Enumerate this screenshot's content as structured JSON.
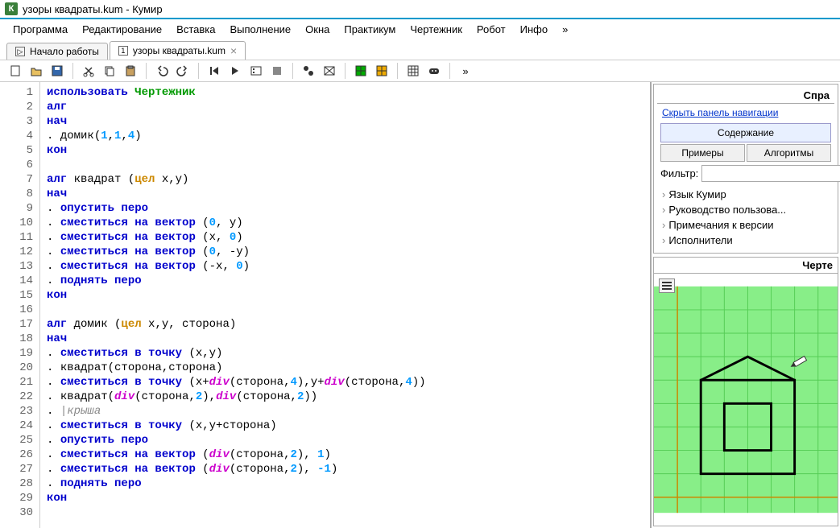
{
  "title": "узоры квадраты.kum - Кумир",
  "app_icon_letter": "К",
  "menu": [
    "Программа",
    "Редактирование",
    "Вставка",
    "Выполнение",
    "Окна",
    "Практикум",
    "Чертежник",
    "Робот",
    "Инфо",
    "»"
  ],
  "tabs": [
    {
      "label": "Начало работы",
      "icon": "▷",
      "closable": false
    },
    {
      "label": "узоры квадраты.kum",
      "icon": "1",
      "closable": true
    }
  ],
  "active_tab": 1,
  "code_lines": [
    {
      "n": 1,
      "segs": [
        {
          "t": "использовать ",
          "c": "kw"
        },
        {
          "t": "Чертежник",
          "c": "fn"
        }
      ]
    },
    {
      "n": 2,
      "segs": [
        {
          "t": "алг",
          "c": "kw"
        }
      ]
    },
    {
      "n": 3,
      "segs": [
        {
          "t": "нач",
          "c": "kw"
        }
      ]
    },
    {
      "n": 4,
      "segs": [
        {
          "t": ". ",
          "c": "dot"
        },
        {
          "t": "домик(",
          "c": ""
        },
        {
          "t": "1",
          "c": "num"
        },
        {
          "t": ",",
          "c": ""
        },
        {
          "t": "1",
          "c": "num"
        },
        {
          "t": ",",
          "c": ""
        },
        {
          "t": "4",
          "c": "num"
        },
        {
          "t": ")",
          "c": ""
        }
      ]
    },
    {
      "n": 5,
      "segs": [
        {
          "t": "кон",
          "c": "kw"
        }
      ]
    },
    {
      "n": 6,
      "segs": []
    },
    {
      "n": 7,
      "segs": [
        {
          "t": "алг ",
          "c": "kw"
        },
        {
          "t": "квадрат (",
          "c": ""
        },
        {
          "t": "цел",
          "c": "ty"
        },
        {
          "t": " x,y)",
          "c": ""
        }
      ]
    },
    {
      "n": 8,
      "segs": [
        {
          "t": "нач",
          "c": "kw"
        }
      ]
    },
    {
      "n": 9,
      "segs": [
        {
          "t": ". ",
          "c": "dot"
        },
        {
          "t": "опустить перо",
          "c": "kw"
        }
      ]
    },
    {
      "n": 10,
      "segs": [
        {
          "t": ". ",
          "c": "dot"
        },
        {
          "t": "сместиться на вектор",
          "c": "kw"
        },
        {
          "t": " (",
          "c": ""
        },
        {
          "t": "0",
          "c": "num"
        },
        {
          "t": ", y)",
          "c": ""
        }
      ]
    },
    {
      "n": 11,
      "segs": [
        {
          "t": ". ",
          "c": "dot"
        },
        {
          "t": "сместиться на вектор",
          "c": "kw"
        },
        {
          "t": " (x, ",
          "c": ""
        },
        {
          "t": "0",
          "c": "num"
        },
        {
          "t": ")",
          "c": ""
        }
      ]
    },
    {
      "n": 12,
      "segs": [
        {
          "t": ". ",
          "c": "dot"
        },
        {
          "t": "сместиться на вектор",
          "c": "kw"
        },
        {
          "t": " (",
          "c": ""
        },
        {
          "t": "0",
          "c": "num"
        },
        {
          "t": ", -y)",
          "c": ""
        }
      ]
    },
    {
      "n": 13,
      "segs": [
        {
          "t": ". ",
          "c": "dot"
        },
        {
          "t": "сместиться на вектор",
          "c": "kw"
        },
        {
          "t": " (-x, ",
          "c": ""
        },
        {
          "t": "0",
          "c": "num"
        },
        {
          "t": ")",
          "c": ""
        }
      ]
    },
    {
      "n": 14,
      "segs": [
        {
          "t": ". ",
          "c": "dot"
        },
        {
          "t": "поднять перо",
          "c": "kw"
        }
      ]
    },
    {
      "n": 15,
      "segs": [
        {
          "t": "кон",
          "c": "kw"
        }
      ]
    },
    {
      "n": 16,
      "segs": []
    },
    {
      "n": 17,
      "segs": [
        {
          "t": "алг ",
          "c": "kw"
        },
        {
          "t": "домик (",
          "c": ""
        },
        {
          "t": "цел",
          "c": "ty"
        },
        {
          "t": " x,y, сторона)",
          "c": ""
        }
      ]
    },
    {
      "n": 18,
      "segs": [
        {
          "t": "нач",
          "c": "kw"
        }
      ]
    },
    {
      "n": 19,
      "segs": [
        {
          "t": ". ",
          "c": "dot"
        },
        {
          "t": "сместиться в точку",
          "c": "kw"
        },
        {
          "t": " (x,y)",
          "c": ""
        }
      ]
    },
    {
      "n": 20,
      "segs": [
        {
          "t": ". ",
          "c": "dot"
        },
        {
          "t": "квадрат(сторона,сторона)",
          "c": ""
        }
      ]
    },
    {
      "n": 21,
      "segs": [
        {
          "t": ". ",
          "c": "dot"
        },
        {
          "t": "сместиться в точку",
          "c": "kw"
        },
        {
          "t": " (x+",
          "c": ""
        },
        {
          "t": "div",
          "c": "op"
        },
        {
          "t": "(сторона,",
          "c": ""
        },
        {
          "t": "4",
          "c": "num"
        },
        {
          "t": "),y+",
          "c": ""
        },
        {
          "t": "div",
          "c": "op"
        },
        {
          "t": "(сторона,",
          "c": ""
        },
        {
          "t": "4",
          "c": "num"
        },
        {
          "t": "))",
          "c": ""
        }
      ]
    },
    {
      "n": 22,
      "segs": [
        {
          "t": ". ",
          "c": "dot"
        },
        {
          "t": "квадрат(",
          "c": ""
        },
        {
          "t": "div",
          "c": "op"
        },
        {
          "t": "(сторона,",
          "c": ""
        },
        {
          "t": "2",
          "c": "num"
        },
        {
          "t": "),",
          "c": ""
        },
        {
          "t": "div",
          "c": "op"
        },
        {
          "t": "(сторона,",
          "c": ""
        },
        {
          "t": "2",
          "c": "num"
        },
        {
          "t": "))",
          "c": ""
        }
      ]
    },
    {
      "n": 23,
      "segs": [
        {
          "t": ". ",
          "c": "dot"
        },
        {
          "t": "|крыша",
          "c": "cm"
        }
      ]
    },
    {
      "n": 24,
      "segs": [
        {
          "t": ". ",
          "c": "dot"
        },
        {
          "t": "сместиться в точку",
          "c": "kw"
        },
        {
          "t": " (x,y+сторона)",
          "c": ""
        }
      ]
    },
    {
      "n": 25,
      "segs": [
        {
          "t": ". ",
          "c": "dot"
        },
        {
          "t": "опустить перо",
          "c": "kw"
        }
      ]
    },
    {
      "n": 26,
      "segs": [
        {
          "t": ". ",
          "c": "dot"
        },
        {
          "t": "сместиться на вектор",
          "c": "kw"
        },
        {
          "t": " (",
          "c": ""
        },
        {
          "t": "div",
          "c": "op"
        },
        {
          "t": "(сторона,",
          "c": ""
        },
        {
          "t": "2",
          "c": "num"
        },
        {
          "t": "), ",
          "c": ""
        },
        {
          "t": "1",
          "c": "num"
        },
        {
          "t": ")",
          "c": ""
        }
      ]
    },
    {
      "n": 27,
      "segs": [
        {
          "t": ". ",
          "c": "dot"
        },
        {
          "t": "сместиться на вектор",
          "c": "kw"
        },
        {
          "t": " (",
          "c": ""
        },
        {
          "t": "div",
          "c": "op"
        },
        {
          "t": "(сторона,",
          "c": ""
        },
        {
          "t": "2",
          "c": "num"
        },
        {
          "t": "), ",
          "c": ""
        },
        {
          "t": "-1",
          "c": "num"
        },
        {
          "t": ")",
          "c": ""
        }
      ]
    },
    {
      "n": 28,
      "segs": [
        {
          "t": ". ",
          "c": "dot"
        },
        {
          "t": "поднять перо",
          "c": "kw"
        }
      ]
    },
    {
      "n": 29,
      "segs": [
        {
          "t": "кон",
          "c": "kw"
        }
      ]
    },
    {
      "n": 30,
      "segs": []
    }
  ],
  "help": {
    "title": "Спра",
    "hide_link": "Скрыть панель навигации",
    "content_btn": "Содержание",
    "examples_btn": "Примеры",
    "algorithms_btn": "Алгоритмы",
    "filter_label": "Фильтр:",
    "tree": [
      "Язык Кумир",
      "Руководство пользова...",
      "Примечания к версии",
      "Исполнители"
    ]
  },
  "canvas": {
    "title": "Черте"
  }
}
